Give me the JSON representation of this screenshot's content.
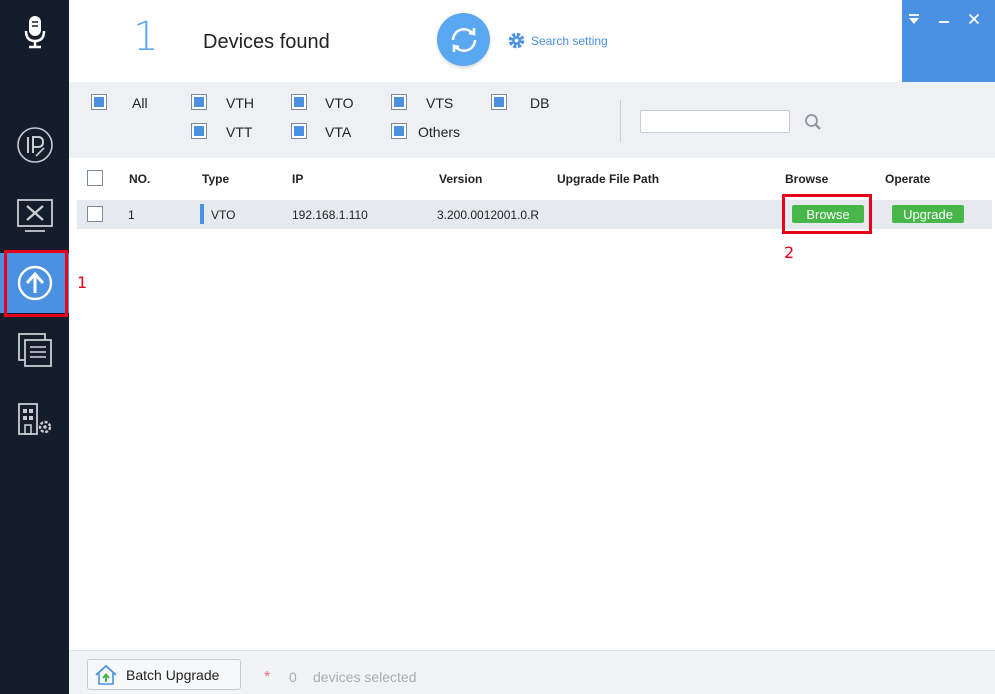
{
  "sidebar": {
    "items": [
      {
        "icon": "microphone-icon"
      },
      {
        "icon": "ip-config-icon"
      },
      {
        "icon": "device-config-icon"
      },
      {
        "icon": "upgrade-icon",
        "active": true
      },
      {
        "icon": "document-list-icon"
      },
      {
        "icon": "building-settings-icon"
      }
    ],
    "annotation": "1"
  },
  "header": {
    "device_count": "1",
    "found_label": "Devices found",
    "search_setting_label": "Search setting"
  },
  "filter": {
    "options": [
      {
        "label": "All",
        "checked": true
      },
      {
        "label": "VTH",
        "checked": true
      },
      {
        "label": "VTO",
        "checked": true
      },
      {
        "label": "VTS",
        "checked": true
      },
      {
        "label": "DB",
        "checked": true
      },
      {
        "label": "VTT",
        "checked": true
      },
      {
        "label": "VTA",
        "checked": true
      },
      {
        "label": "Others",
        "checked": true
      }
    ],
    "search_value": ""
  },
  "table": {
    "columns": [
      "NO.",
      "Type",
      "IP",
      "Version",
      "Upgrade File Path",
      "Browse",
      "Operate"
    ],
    "rows": [
      {
        "no": "1",
        "type": "VTO",
        "ip": "192.168.1.110",
        "version": "3.200.0012001.0.R",
        "file_path": "",
        "browse_label": "Browse",
        "operate_label": "Upgrade"
      }
    ],
    "annotation": "2"
  },
  "footer": {
    "batch_upgrade_label": "Batch Upgrade",
    "star": "*",
    "selected_count": "0",
    "selected_label": "devices selected"
  },
  "colors": {
    "sidebar_bg": "#141d2b",
    "accent": "#4b91e2",
    "button_green": "#47b74a",
    "highlight_red": "#e8001c"
  }
}
